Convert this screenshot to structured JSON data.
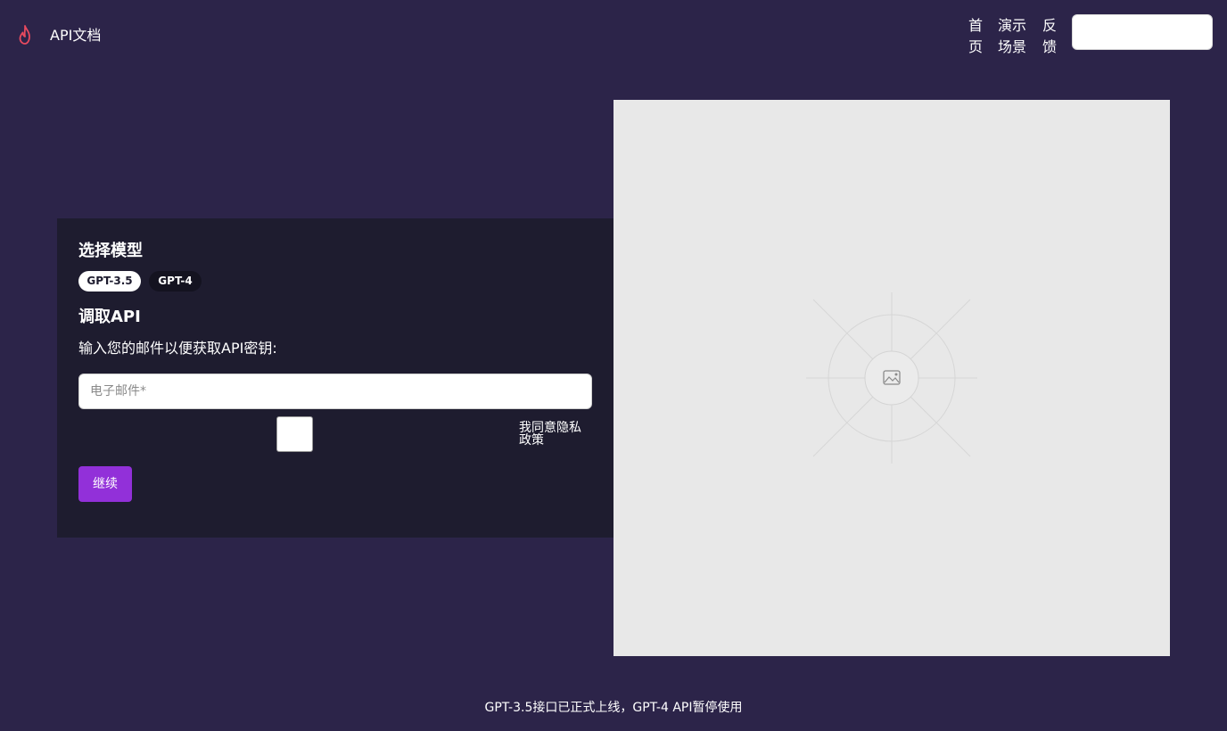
{
  "header": {
    "brand_label": "API文档",
    "nav": {
      "home": "首页",
      "demo": "演示场景",
      "feedback": "反馈"
    },
    "search_value": ""
  },
  "panel": {
    "model_title": "选择模型",
    "models": [
      {
        "label": "GPT-3.5",
        "selected": true
      },
      {
        "label": "GPT-4",
        "selected": false
      }
    ],
    "api_title": "调取API",
    "description": "输入您的邮件以便获取API密钥:",
    "email_placeholder": "电子邮件*",
    "privacy_label": "我同意隐私政策",
    "privacy_checked": false,
    "submit_label": "继续"
  },
  "footer": {
    "notice": "GPT-3.5接口已正式上线，GPT-4 API暂停使用"
  },
  "icons": {
    "logo": "flame-icon",
    "image_placeholder": "image-icon"
  },
  "colors": {
    "page_background": "#2c2449",
    "panel_background": "#1e1c2f",
    "accent": "#9230d9",
    "logo": "#e84a5f",
    "placeholder_background": "#e8e8e8"
  }
}
